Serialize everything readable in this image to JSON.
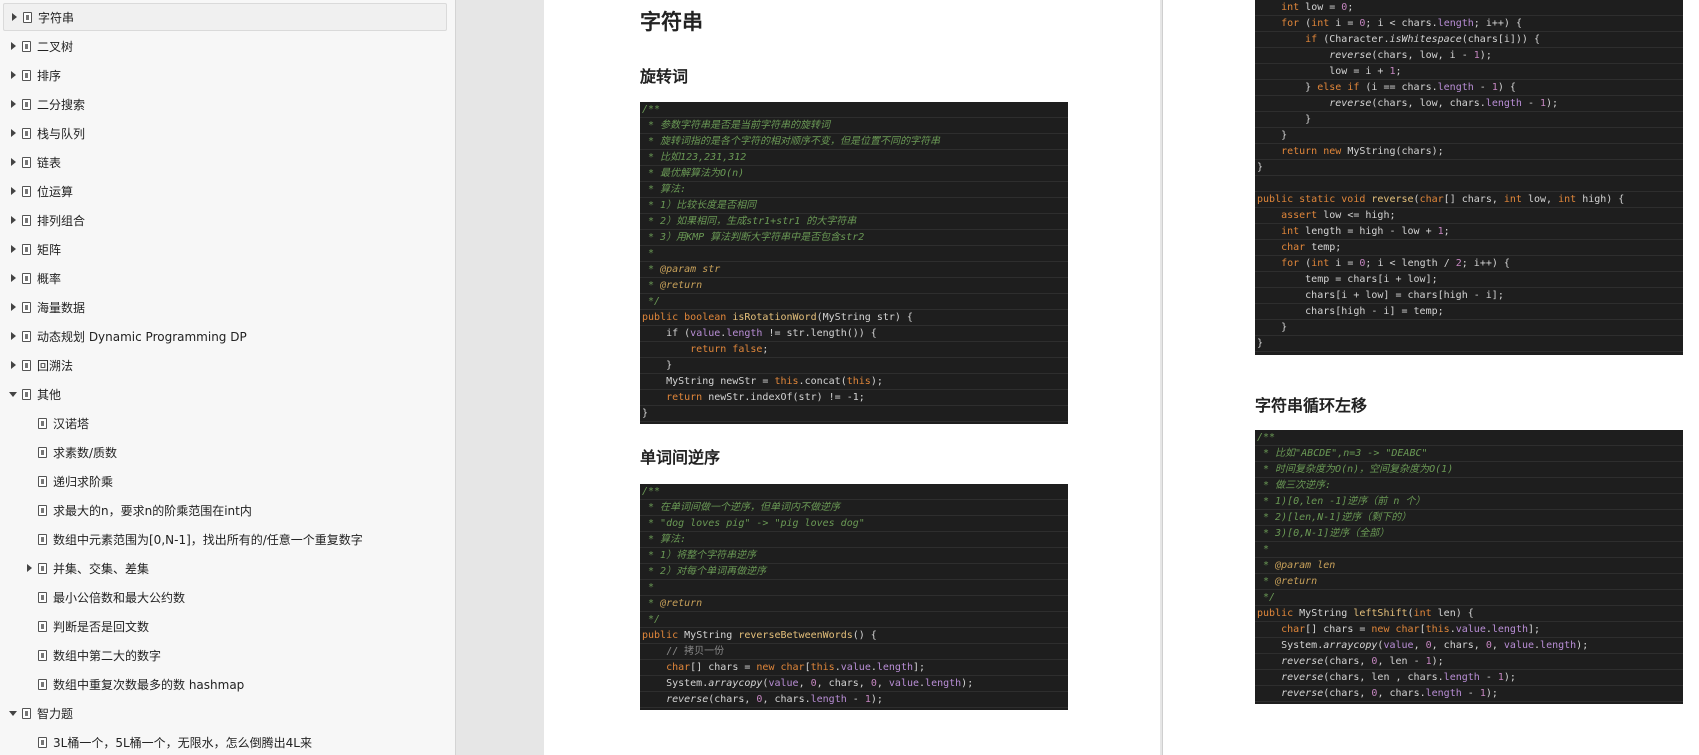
{
  "sidebar": {
    "items": [
      {
        "label": "字符串",
        "level": 0,
        "toggle": "collapsed",
        "selected": true
      },
      {
        "label": "二叉树",
        "level": 0,
        "toggle": "collapsed"
      },
      {
        "label": "排序",
        "level": 0,
        "toggle": "collapsed"
      },
      {
        "label": "二分搜索",
        "level": 0,
        "toggle": "collapsed"
      },
      {
        "label": "栈与队列",
        "level": 0,
        "toggle": "collapsed"
      },
      {
        "label": "链表",
        "level": 0,
        "toggle": "collapsed"
      },
      {
        "label": "位运算",
        "level": 0,
        "toggle": "collapsed"
      },
      {
        "label": "排列组合",
        "level": 0,
        "toggle": "collapsed"
      },
      {
        "label": "矩阵",
        "level": 0,
        "toggle": "collapsed"
      },
      {
        "label": "概率",
        "level": 0,
        "toggle": "collapsed"
      },
      {
        "label": "海量数据",
        "level": 0,
        "toggle": "collapsed"
      },
      {
        "label": "动态规划 Dynamic Programming DP",
        "level": 0,
        "toggle": "collapsed"
      },
      {
        "label": "回溯法",
        "level": 0,
        "toggle": "collapsed"
      },
      {
        "label": "其他",
        "level": 0,
        "toggle": "expanded"
      },
      {
        "label": "汉诺塔",
        "level": 1,
        "toggle": "none"
      },
      {
        "label": "求素数/质数",
        "level": 1,
        "toggle": "none"
      },
      {
        "label": "递归求阶乘",
        "level": 1,
        "toggle": "none"
      },
      {
        "label": "求最大的n，要求n的阶乘范围在int内",
        "level": 1,
        "toggle": "none"
      },
      {
        "label": "数组中元素范围为[0,N-1]，找出所有的/任意一个重复数字",
        "level": 1,
        "toggle": "none"
      },
      {
        "label": "并集、交集、差集",
        "level": 1,
        "toggle": "collapsed"
      },
      {
        "label": "最小公倍数和最大公约数",
        "level": 1,
        "toggle": "none"
      },
      {
        "label": "判断是否是回文数",
        "level": 1,
        "toggle": "none"
      },
      {
        "label": "数组中第二大的数字",
        "level": 1,
        "toggle": "none"
      },
      {
        "label": "数组中重复次数最多的数 hashmap",
        "level": 1,
        "toggle": "none"
      },
      {
        "label": "智力题",
        "level": 0,
        "toggle": "expanded"
      },
      {
        "label": "3L桶一个，5L桶一个，无限水，怎么倒腾出4L来",
        "level": 1,
        "toggle": "none"
      }
    ]
  },
  "page1": {
    "h1": "字符串",
    "h2a": "旋转词",
    "h2b": "单词间逆序",
    "code1": [
      [
        [
          "/**",
          "cm"
        ]
      ],
      [
        [
          " * 参数字符串是否是当前字符串的旋转词",
          "cm"
        ]
      ],
      [
        [
          " * 旋转词指的是各个字符的相对顺序不变，但是位置不同的字符串",
          "cm"
        ]
      ],
      [
        [
          " * 比如123,231,312",
          "cm"
        ]
      ],
      [
        [
          " * 最优解算法为O(n)",
          "cm"
        ]
      ],
      [
        [
          " * 算法:",
          "cm"
        ]
      ],
      [
        [
          " * 1）比较长度是否相同",
          "cm"
        ]
      ],
      [
        [
          " * 2）如果相同，生成str1+str1 的大字符串",
          "cm"
        ]
      ],
      [
        [
          " * 3）用KMP 算法判断大字符串中是否包含str2",
          "cm"
        ]
      ],
      [
        [
          " *",
          "cm"
        ]
      ],
      [
        [
          " * ",
          "cm"
        ],
        [
          "@param",
          "ann"
        ],
        [
          " str",
          "ann"
        ]
      ],
      [
        [
          " * ",
          "cm"
        ],
        [
          "@return",
          "ann"
        ]
      ],
      [
        [
          " */",
          "cm"
        ]
      ],
      [
        [
          "public boolean ",
          "kw"
        ],
        [
          "isRotationWord",
          "fn"
        ],
        [
          "(MyString str) {",
          ""
        ]
      ],
      [
        [
          "    if (",
          ""
        ],
        [
          "value",
          "fld"
        ],
        [
          ".",
          ""
        ],
        [
          "length",
          "fld"
        ],
        [
          " != str.length()) {",
          ""
        ]
      ],
      [
        [
          "        return false",
          "kw"
        ],
        [
          ";",
          ""
        ]
      ],
      [
        [
          "    }",
          ""
        ]
      ],
      [
        [
          "    MyString newStr = ",
          ""
        ],
        [
          "this",
          "kw"
        ],
        [
          ".concat(",
          ""
        ],
        [
          "this",
          "kw"
        ],
        [
          ");",
          ""
        ]
      ],
      [
        [
          "    return ",
          "kw"
        ],
        [
          "newStr.indexOf(str) != ",
          ""
        ],
        [
          "-1",
          ""
        ],
        [
          ";",
          ""
        ]
      ],
      [
        [
          "}",
          ""
        ]
      ]
    ],
    "code2": [
      [
        [
          "/**",
          "cm"
        ]
      ],
      [
        [
          " * 在单词间做一个逆序，但单词内不做逆序",
          "cm"
        ]
      ],
      [
        [
          " * \"dog loves pig\" -> \"pig loves dog\"",
          "cm"
        ]
      ],
      [
        [
          " * 算法:",
          "cm"
        ]
      ],
      [
        [
          " * 1）将整个字符串逆序",
          "cm"
        ]
      ],
      [
        [
          " * 2）对每个单词再做逆序",
          "cm"
        ]
      ],
      [
        [
          " *",
          "cm"
        ]
      ],
      [
        [
          " * ",
          "cm"
        ],
        [
          "@return",
          "ann"
        ]
      ],
      [
        [
          " */",
          "cm"
        ]
      ],
      [
        [
          "public ",
          "kw"
        ],
        [
          "MyString ",
          ""
        ],
        [
          "reverseBetweenWords",
          "fn"
        ],
        [
          "() {",
          ""
        ]
      ],
      [
        [
          "    // 拷贝一份",
          "cmg"
        ]
      ],
      [
        [
          "    char",
          "kw"
        ],
        [
          "[] chars = ",
          ""
        ],
        [
          "new char",
          "kw"
        ],
        [
          "[",
          ""
        ],
        [
          "this",
          "kw"
        ],
        [
          ".",
          ""
        ],
        [
          "value",
          "fld"
        ],
        [
          ".",
          ""
        ],
        [
          "length",
          "fld"
        ],
        [
          "];",
          ""
        ]
      ],
      [
        [
          "    System.",
          ""
        ],
        [
          "arraycopy",
          "it"
        ],
        [
          "(",
          ""
        ],
        [
          "value",
          "fld"
        ],
        [
          ", ",
          ""
        ],
        [
          "0",
          "num"
        ],
        [
          ", chars, ",
          ""
        ],
        [
          "0",
          "num"
        ],
        [
          ", ",
          ""
        ],
        [
          "value",
          "fld"
        ],
        [
          ".",
          ""
        ],
        [
          "length",
          "fld"
        ],
        [
          ");",
          ""
        ]
      ],
      [
        [
          "    ",
          ""
        ],
        [
          "reverse",
          "it"
        ],
        [
          "(chars, ",
          ""
        ],
        [
          "0",
          "num"
        ],
        [
          ", chars.",
          ""
        ],
        [
          "length",
          "fld"
        ],
        [
          " - ",
          ""
        ],
        [
          "1",
          "num"
        ],
        [
          ");",
          ""
        ]
      ]
    ]
  },
  "page2": {
    "h2c": "字符串循环左移",
    "code3": [
      [
        [
          "    int ",
          "kw"
        ],
        [
          "low = ",
          ""
        ],
        [
          "0",
          "num"
        ],
        [
          ";",
          ""
        ]
      ],
      [
        [
          "    for ",
          "kw"
        ],
        [
          "(",
          ""
        ],
        [
          "int ",
          "kw"
        ],
        [
          "i = ",
          ""
        ],
        [
          "0",
          "num"
        ],
        [
          "; i < chars.",
          ""
        ],
        [
          "length",
          "fld"
        ],
        [
          "; i++) {",
          ""
        ]
      ],
      [
        [
          "        if ",
          "kw"
        ],
        [
          "(Character.",
          ""
        ],
        [
          "isWhitespace",
          "it"
        ],
        [
          "(chars[i])) {",
          ""
        ]
      ],
      [
        [
          "            ",
          ""
        ],
        [
          "reverse",
          "it"
        ],
        [
          "(chars, low, i - ",
          ""
        ],
        [
          "1",
          "num"
        ],
        [
          ");",
          ""
        ]
      ],
      [
        [
          "            low = i + ",
          ""
        ],
        [
          "1",
          "num"
        ],
        [
          ";",
          ""
        ]
      ],
      [
        [
          "        } ",
          ""
        ],
        [
          "else if ",
          "kw"
        ],
        [
          "(i == chars.",
          ""
        ],
        [
          "length",
          "fld"
        ],
        [
          " - ",
          ""
        ],
        [
          "1",
          "num"
        ],
        [
          ") {",
          ""
        ]
      ],
      [
        [
          "            ",
          ""
        ],
        [
          "reverse",
          "it"
        ],
        [
          "(chars, low, chars.",
          ""
        ],
        [
          "length",
          "fld"
        ],
        [
          " - ",
          ""
        ],
        [
          "1",
          "num"
        ],
        [
          ");",
          ""
        ]
      ],
      [
        [
          "        }",
          ""
        ]
      ],
      [
        [
          "    }",
          ""
        ]
      ],
      [
        [
          "    return new ",
          "kw"
        ],
        [
          "MyString(chars);",
          ""
        ]
      ],
      [
        [
          "}",
          ""
        ]
      ],
      [
        [
          "",
          ""
        ]
      ],
      [
        [
          "public static void ",
          "kw"
        ],
        [
          "reverse",
          "fn"
        ],
        [
          "(",
          ""
        ],
        [
          "char",
          "kw"
        ],
        [
          "[] chars, ",
          ""
        ],
        [
          "int ",
          "kw"
        ],
        [
          "low, ",
          ""
        ],
        [
          "int ",
          "kw"
        ],
        [
          "high) {",
          ""
        ]
      ],
      [
        [
          "    assert ",
          "kw"
        ],
        [
          "low <= high;",
          ""
        ]
      ],
      [
        [
          "    int ",
          "kw"
        ],
        [
          "length = high - low + ",
          ""
        ],
        [
          "1",
          "num"
        ],
        [
          ";",
          ""
        ]
      ],
      [
        [
          "    char ",
          "kw"
        ],
        [
          "temp;",
          ""
        ]
      ],
      [
        [
          "    for ",
          "kw"
        ],
        [
          "(",
          ""
        ],
        [
          "int ",
          "kw"
        ],
        [
          "i = ",
          ""
        ],
        [
          "0",
          "num"
        ],
        [
          "; i < length / ",
          ""
        ],
        [
          "2",
          "num"
        ],
        [
          "; i++) {",
          ""
        ]
      ],
      [
        [
          "        temp = chars[i + low];",
          ""
        ]
      ],
      [
        [
          "        chars[i + low] = chars[high - i];",
          ""
        ]
      ],
      [
        [
          "        chars[high - i] = temp;",
          ""
        ]
      ],
      [
        [
          "    }",
          ""
        ]
      ],
      [
        [
          "}",
          ""
        ]
      ]
    ],
    "code4": [
      [
        [
          "/**",
          "cm"
        ]
      ],
      [
        [
          " * 比如\"ABCDE\",n=3 -> \"DEABC\"",
          "cm"
        ]
      ],
      [
        [
          " * 时间复杂度为O(n)，空间复杂度为O(1)",
          "cm"
        ]
      ],
      [
        [
          " * 做三次逆序:",
          "cm"
        ]
      ],
      [
        [
          " * 1)[0,len -1]逆序（前 n 个）",
          "cm"
        ]
      ],
      [
        [
          " * 2)[len,N-1]逆序（剩下的）",
          "cm"
        ]
      ],
      [
        [
          " * 3)[0,N-1]逆序（全部）",
          "cm"
        ]
      ],
      [
        [
          " *",
          "cm"
        ]
      ],
      [
        [
          " * ",
          "cm"
        ],
        [
          "@param",
          "ann"
        ],
        [
          " len",
          "ann"
        ]
      ],
      [
        [
          " * ",
          "cm"
        ],
        [
          "@return",
          "ann"
        ]
      ],
      [
        [
          " */",
          "cm"
        ]
      ],
      [
        [
          "public ",
          "kw"
        ],
        [
          "MyString ",
          ""
        ],
        [
          "leftShift",
          "fn"
        ],
        [
          "(",
          ""
        ],
        [
          "int ",
          "kw"
        ],
        [
          "len) {",
          ""
        ]
      ],
      [
        [
          "    char",
          "kw"
        ],
        [
          "[] chars = ",
          ""
        ],
        [
          "new char",
          "kw"
        ],
        [
          "[",
          ""
        ],
        [
          "this",
          "kw"
        ],
        [
          ".",
          ""
        ],
        [
          "value",
          "fld"
        ],
        [
          ".",
          ""
        ],
        [
          "length",
          "fld"
        ],
        [
          "];",
          ""
        ]
      ],
      [
        [
          "    System.",
          ""
        ],
        [
          "arraycopy",
          "it"
        ],
        [
          "(",
          ""
        ],
        [
          "value",
          "fld"
        ],
        [
          ", ",
          ""
        ],
        [
          "0",
          "num"
        ],
        [
          ", chars, ",
          ""
        ],
        [
          "0",
          "num"
        ],
        [
          ", ",
          ""
        ],
        [
          "value",
          "fld"
        ],
        [
          ".",
          ""
        ],
        [
          "length",
          "fld"
        ],
        [
          ");",
          ""
        ]
      ],
      [
        [
          "    ",
          ""
        ],
        [
          "reverse",
          "it"
        ],
        [
          "(chars, ",
          ""
        ],
        [
          "0",
          "num"
        ],
        [
          ", len - ",
          ""
        ],
        [
          "1",
          "num"
        ],
        [
          ");",
          ""
        ]
      ],
      [
        [
          "    ",
          ""
        ],
        [
          "reverse",
          "it"
        ],
        [
          "(chars, len , chars.",
          ""
        ],
        [
          "length",
          "fld"
        ],
        [
          " - ",
          ""
        ],
        [
          "1",
          "num"
        ],
        [
          ");",
          ""
        ]
      ],
      [
        [
          "    ",
          ""
        ],
        [
          "reverse",
          "it"
        ],
        [
          "(chars, ",
          ""
        ],
        [
          "0",
          "num"
        ],
        [
          ", chars.",
          ""
        ],
        [
          "length",
          "fld"
        ],
        [
          " - ",
          ""
        ],
        [
          "1",
          "num"
        ],
        [
          ");",
          ""
        ]
      ]
    ]
  }
}
